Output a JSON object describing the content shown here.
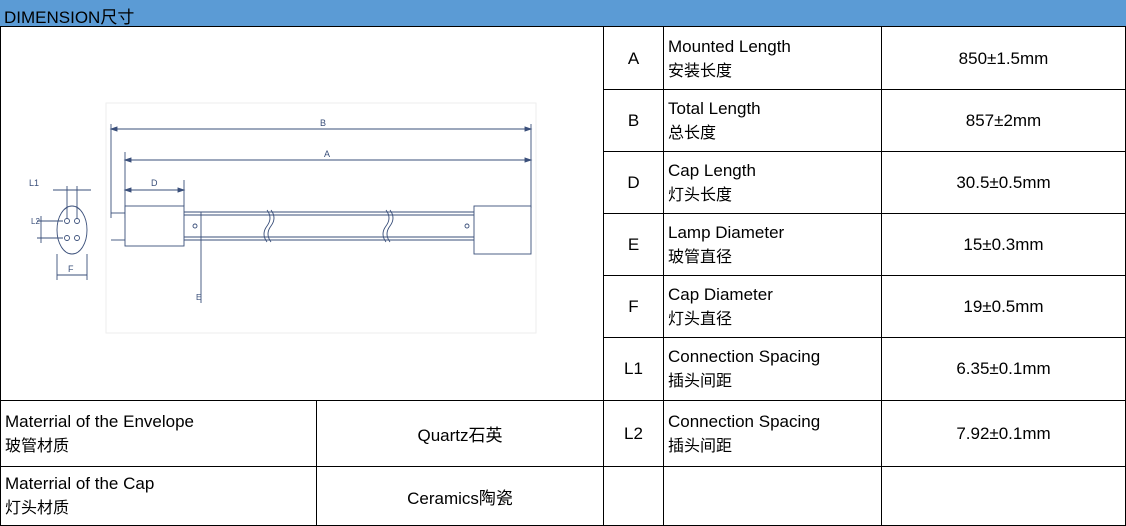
{
  "header": {
    "title": "DIMENSION尺寸"
  },
  "drawing": {
    "labels": {
      "b": "B",
      "a": "A",
      "d": "D",
      "l1": "L1",
      "l2": "L2",
      "f": "F",
      "e": "E"
    }
  },
  "rows": [
    {
      "code": "A",
      "name_en": "Mounted Length",
      "name_zh": "安装长度",
      "value": "850±1.5mm"
    },
    {
      "code": "B",
      "name_en": "Total Length",
      "name_zh": "总长度",
      "value": "857±2mm"
    },
    {
      "code": "D",
      "name_en": "Cap Length",
      "name_zh": "灯头长度",
      "value": "30.5±0.5mm"
    },
    {
      "code": "E",
      "name_en": "Lamp Diameter",
      "name_zh": "玻管直径",
      "value": "15±0.3mm"
    },
    {
      "code": "F",
      "name_en": "Cap Diameter",
      "name_zh": "灯头直径",
      "value": "19±0.5mm"
    },
    {
      "code": "L1",
      "name_en": "Connection Spacing",
      "name_zh": "插头间距",
      "value": "6.35±0.1mm"
    },
    {
      "code": "L2",
      "name_en": "Connection Spacing",
      "name_zh": "插头间距",
      "value": "7.92±0.1mm"
    }
  ],
  "materials": [
    {
      "label_en": "Materrial of the Envelope",
      "label_zh": "玻管材质",
      "value": "Quartz石英"
    },
    {
      "label_en": "Materrial of the Cap",
      "label_zh": "灯头材质",
      "value": "Ceramics陶瓷"
    }
  ]
}
